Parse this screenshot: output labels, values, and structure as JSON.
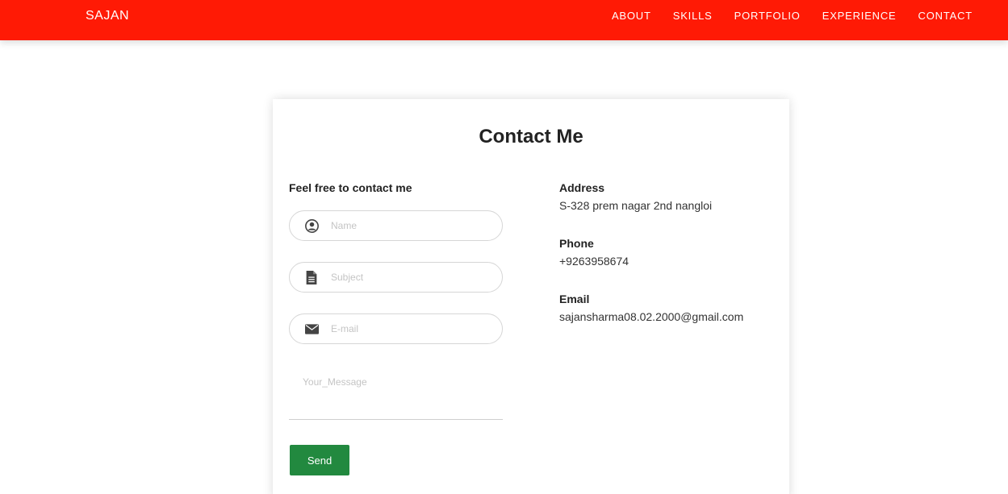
{
  "nav": {
    "brand": "SAJAN",
    "links": [
      "ABOUT",
      "SKILLS",
      "PORTFOLIO",
      "EXPERIENCE",
      "CONTACT"
    ],
    "background_color": "#ff1a05"
  },
  "contact": {
    "title": "Contact Me",
    "form": {
      "heading": "Feel free to contact me",
      "name_placeholder": "Name",
      "subject_placeholder": "Subject",
      "email_placeholder": "E-mail",
      "message_placeholder": "Your_Message",
      "send_label": "Send",
      "send_color": "#22893f"
    },
    "info": {
      "address_label": "Address",
      "address_value": "S-328 prem nagar 2nd nangloi",
      "phone_label": "Phone",
      "phone_value": "+9263958674",
      "email_label": "Email",
      "email_value": "sajansharma08.02.2000@gmail.com"
    }
  },
  "icons": {
    "name_field": "user-circle-icon",
    "subject_field": "document-icon",
    "email_field": "envelope-icon"
  }
}
